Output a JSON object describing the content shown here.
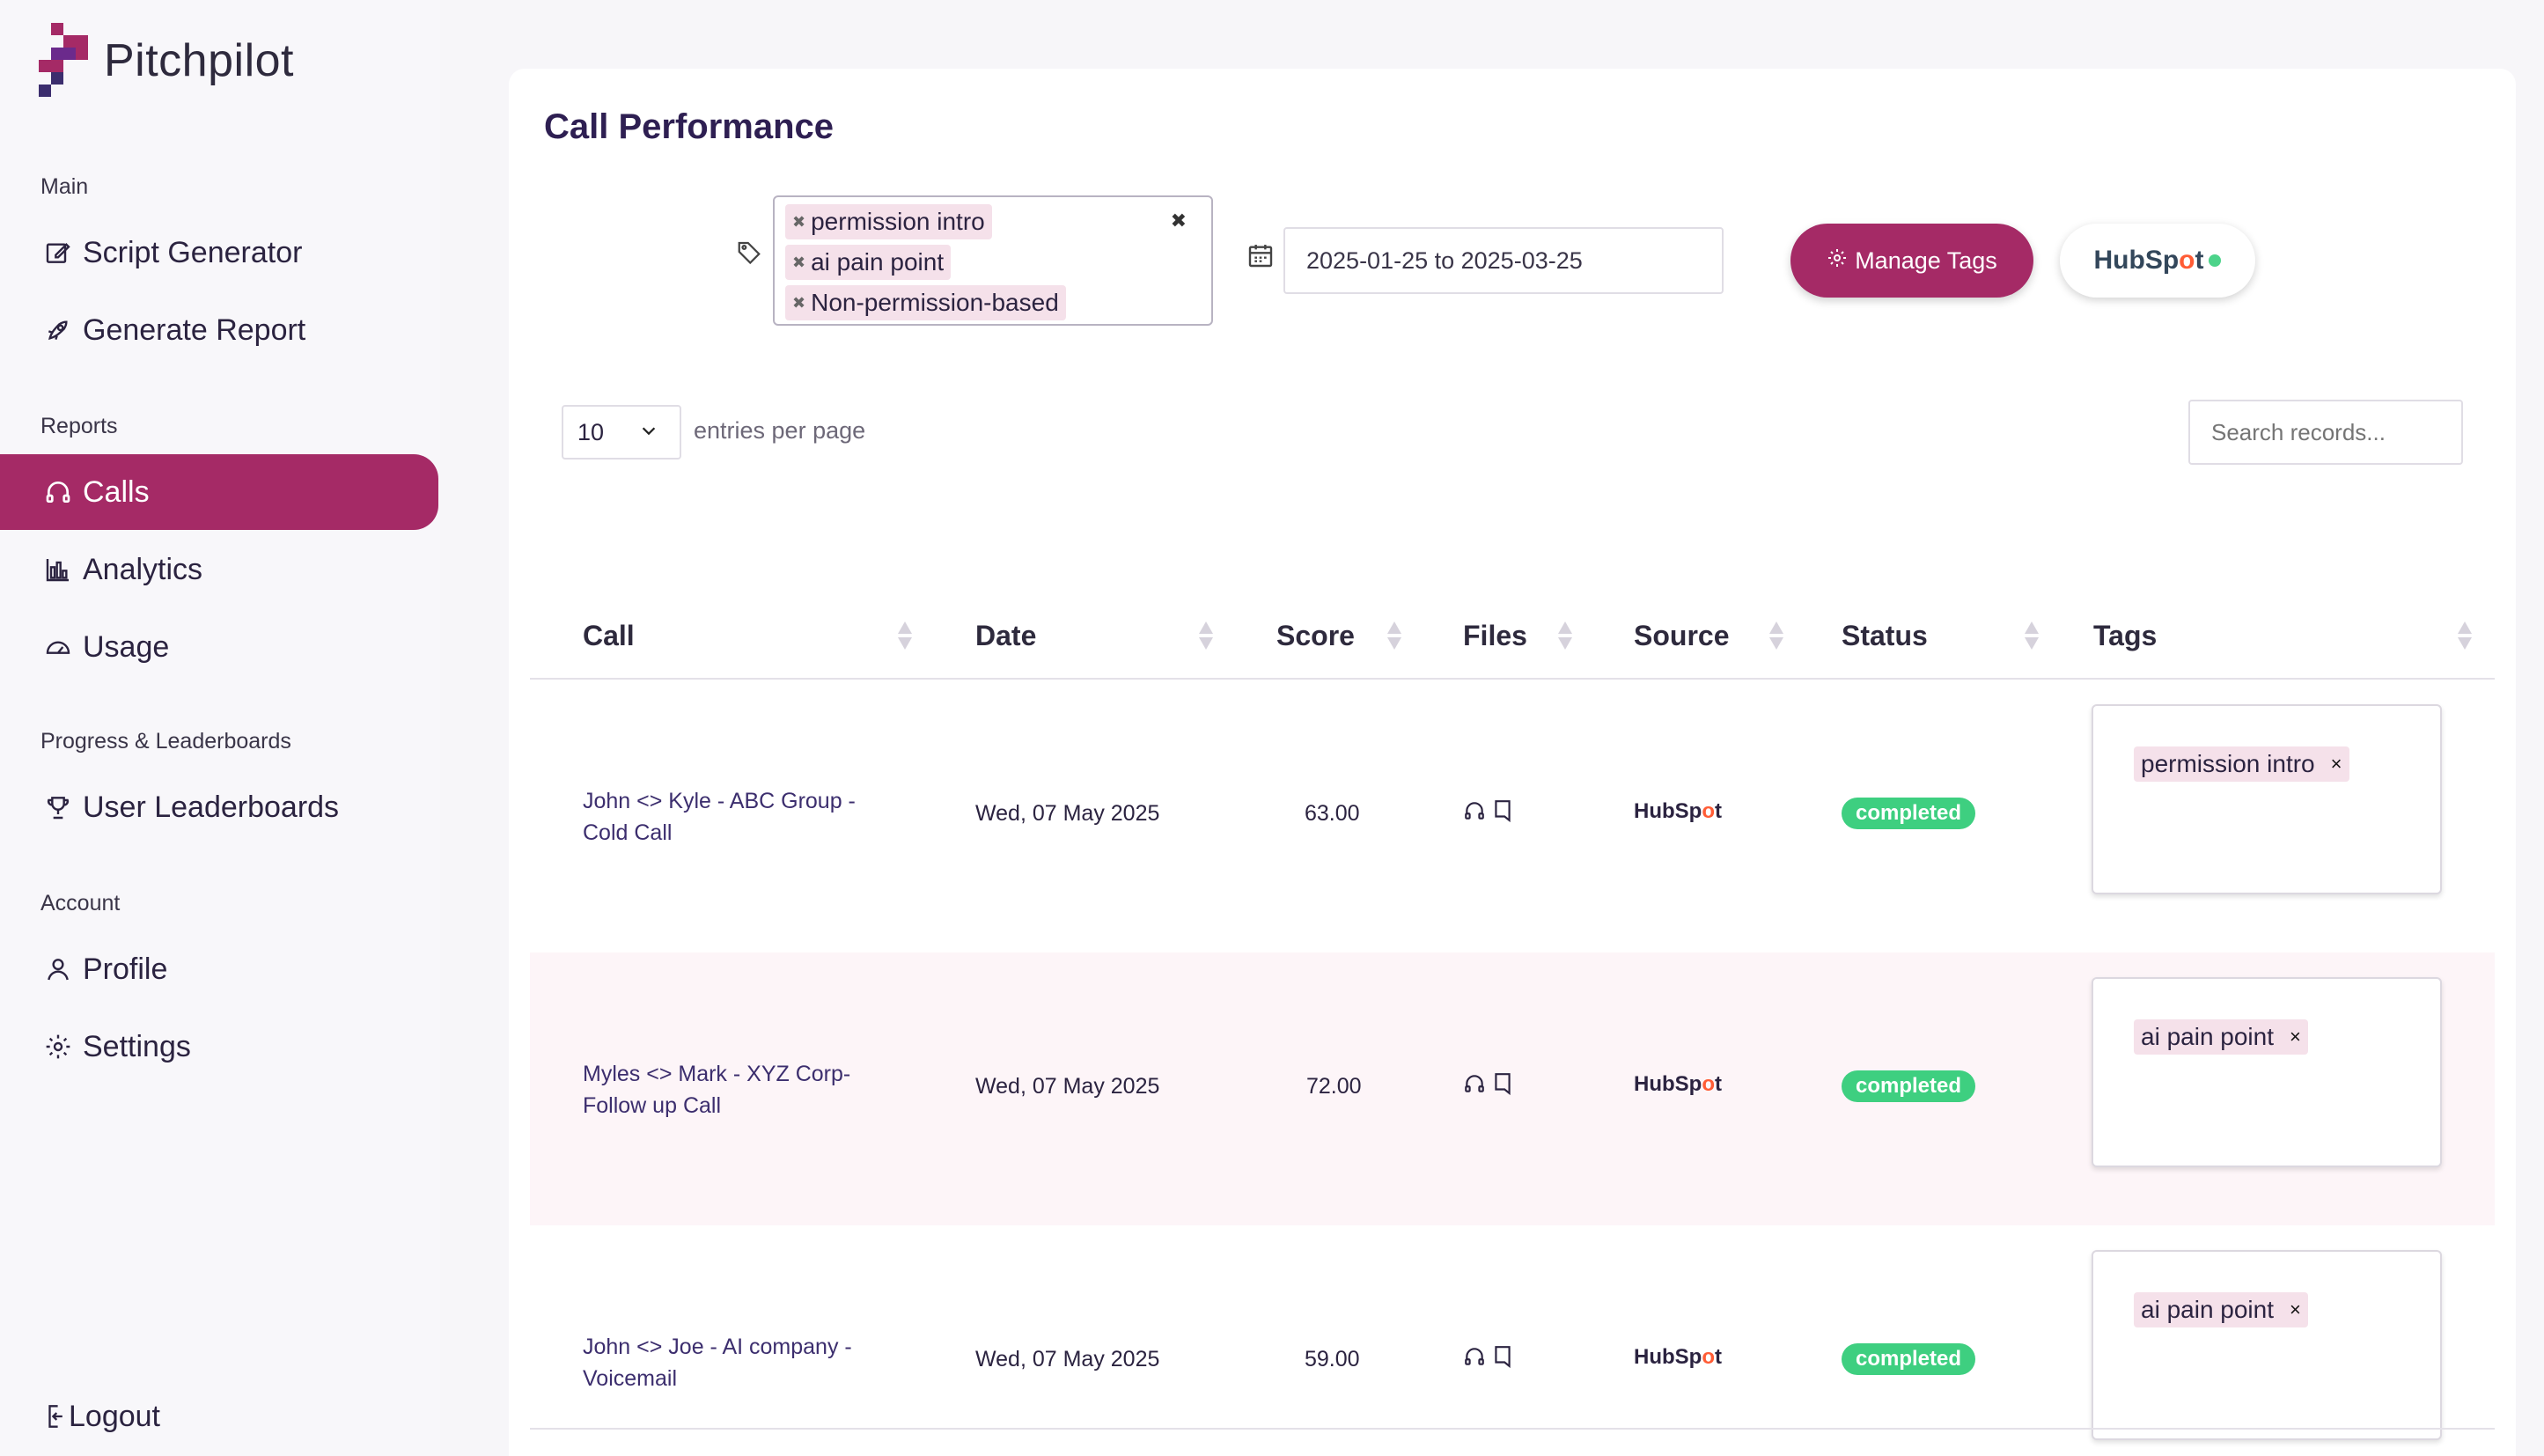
{
  "app": {
    "name": "Pitchpilot"
  },
  "sidebar": {
    "sections": {
      "main": "Main",
      "reports": "Reports",
      "progress": "Progress & Leaderboards",
      "account": "Account"
    },
    "items": {
      "script_generator": "Script Generator",
      "generate_report": "Generate Report",
      "calls": "Calls",
      "analytics": "Analytics",
      "usage": "Usage",
      "user_leaderboards": "User Leaderboards",
      "profile": "Profile",
      "settings": "Settings",
      "logout": "Logout"
    },
    "active": "calls",
    "accent": "#a52a66"
  },
  "main": {
    "title": "Call Performance",
    "filters": {
      "tags": [
        "permission intro",
        "ai pain point",
        "Non-permission-based"
      ],
      "date_range": "2025-01-25 to 2025-03-25",
      "manage_tags_label": "Manage Tags",
      "hubspot_label_a": "HubSp",
      "hubspot_label_o": "o",
      "hubspot_label_b": "t"
    },
    "entries": {
      "value": "10",
      "label": "entries per page"
    },
    "search": {
      "placeholder": "Search records..."
    },
    "table": {
      "headers": [
        "Call",
        "Date",
        "Score",
        "Files",
        "Source",
        "Status",
        "Tags"
      ],
      "rows": [
        {
          "call": "John <> Kyle - ABC Group - Cold Call",
          "date": "Wed, 07 May 2025",
          "score": "63.00",
          "status": "completed",
          "tag": "permission intro"
        },
        {
          "call": "Myles <> Mark - XYZ Corp- Follow up Call",
          "date": "Wed, 07 May 2025",
          "score": "72.00",
          "status": "completed",
          "tag": "ai pain point"
        },
        {
          "call": "John <> Joe - AI company - Voicemail",
          "date": "Wed, 07 May 2025",
          "score": "59.00",
          "status": "completed",
          "tag": "ai pain point"
        }
      ]
    }
  }
}
